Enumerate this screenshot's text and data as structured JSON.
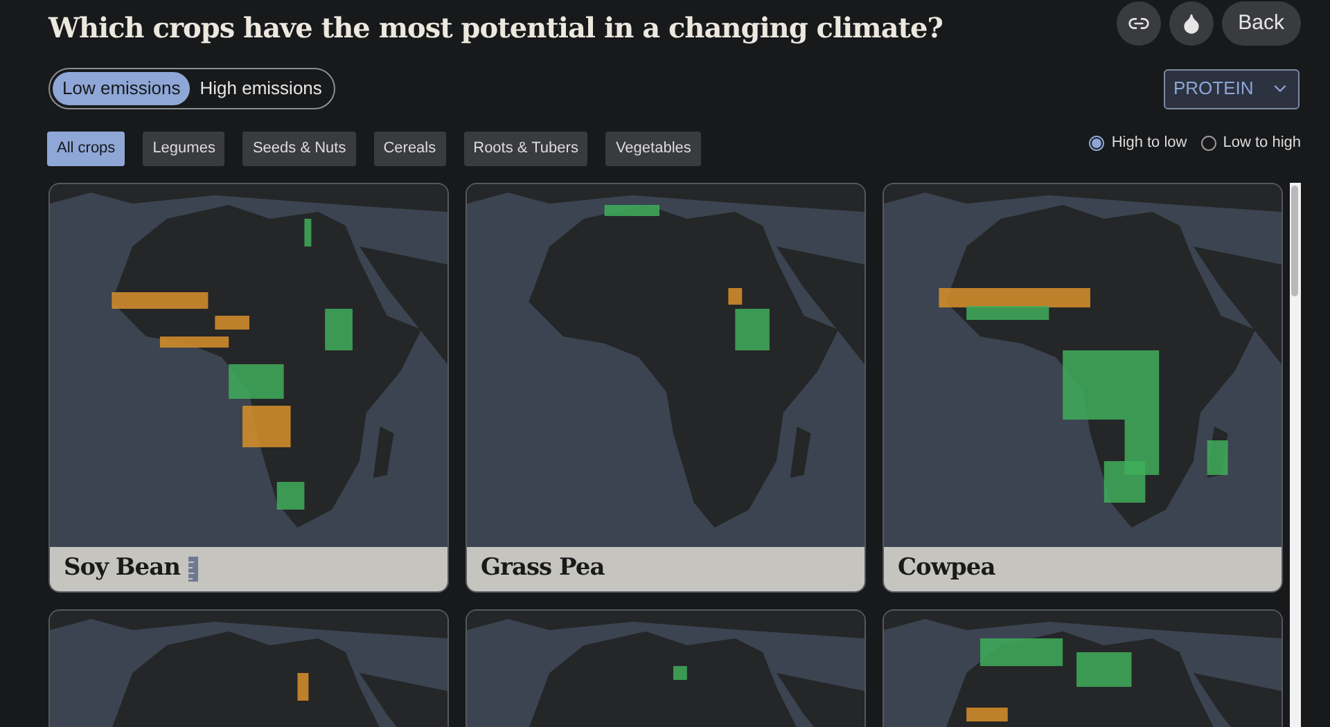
{
  "title": "Which crops have the most potential in a changing climate?",
  "header_buttons": [
    {
      "kind": "link"
    },
    {
      "kind": "drop"
    },
    {
      "kind": "text",
      "label": "Back"
    }
  ],
  "emissions": [
    {
      "label": "Low emissions",
      "selected": true
    },
    {
      "label": "High emissions",
      "selected": false
    }
  ],
  "nutrient_select": {
    "value": "PROTEIN"
  },
  "filters": [
    {
      "label": "All crops",
      "selected": true
    },
    {
      "label": "Legumes",
      "selected": false
    },
    {
      "label": "Seeds & Nuts",
      "selected": false
    },
    {
      "label": "Cereals",
      "selected": false
    },
    {
      "label": "Roots & Tubers",
      "selected": false
    },
    {
      "label": "Vegetables",
      "selected": false
    }
  ],
  "sort": [
    {
      "label": "High to low",
      "selected": true
    },
    {
      "label": "Low to high",
      "selected": false
    }
  ],
  "crops": [
    {
      "kind": "labeled",
      "name": "Soy Bean",
      "ruler": true
    },
    {
      "kind": "labeled",
      "name": "Grass Pea",
      "ruler": false
    },
    {
      "kind": "labeled",
      "name": "Cowpea",
      "ruler": false
    },
    {
      "kind": "map_only"
    },
    {
      "kind": "map_only"
    },
    {
      "kind": "map_only"
    }
  ]
}
